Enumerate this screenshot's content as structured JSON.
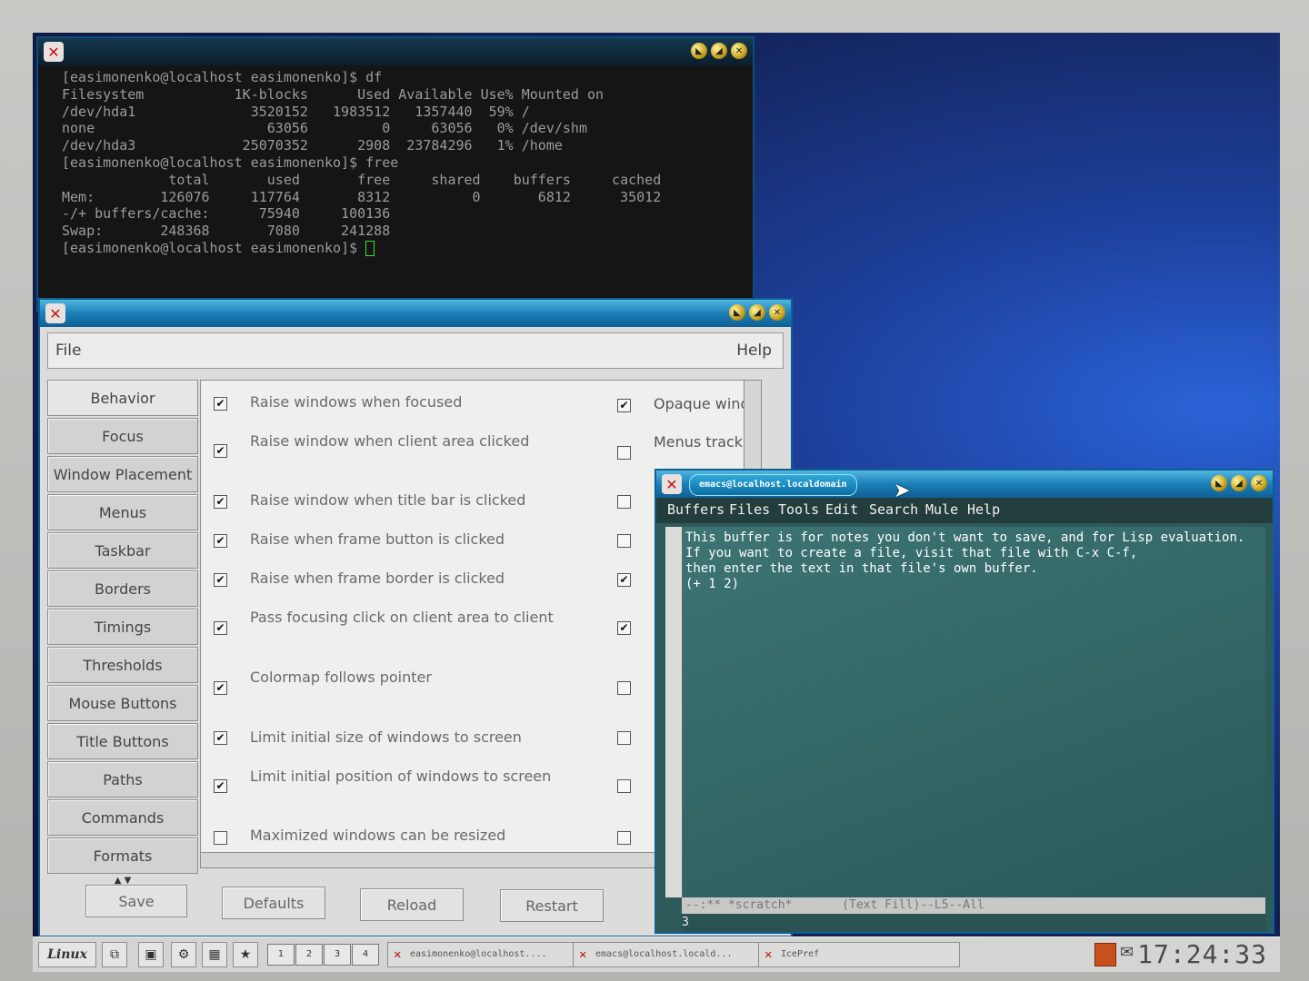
{
  "terminal": {
    "lines": [
      "[easimonenko@localhost easimonenko]$ df",
      "Filesystem           1K-blocks      Used Available Use% Mounted on",
      "/dev/hda1              3520152   1983512   1357440  59% /",
      "none                     63056         0     63056   0% /dev/shm",
      "/dev/hda3             25070352      2908  23784296   1% /home",
      "[easimonenko@localhost easimonenko]$ free",
      "             total       used       free     shared    buffers     cached",
      "Mem:        126076     117764       8312          0       6812      35012",
      "-/+ buffers/cache:      75940     100136",
      "Swap:       248368       7080     241288",
      "[easimonenko@localhost easimonenko]$ "
    ]
  },
  "icepref": {
    "menu_file": "File",
    "menu_help": "Help",
    "tabs": [
      "Behavior",
      "Focus",
      "Window Placement",
      "Menus",
      "Taskbar",
      "Borders",
      "Timings",
      "Thresholds",
      "Mouse Buttons",
      "Title Buttons",
      "Paths",
      "Commands",
      "Formats"
    ],
    "tab_arrows": "▲ ▼",
    "left_options": [
      {
        "label": "Raise windows when focused",
        "checked": "✔"
      },
      {
        "label": "Raise window when client area clicked",
        "checked": "✔"
      },
      {
        "label": "Raise window when title bar is clicked",
        "checked": "✔"
      },
      {
        "label": "Raise when frame button is clicked",
        "checked": "✔"
      },
      {
        "label": "Raise when frame border is clicked",
        "checked": "✔"
      },
      {
        "label": "Pass focusing click on client area to client",
        "checked": "✔"
      },
      {
        "label": "Colormap follows pointer",
        "checked": "✔"
      },
      {
        "label": "Limit initial size of windows to screen",
        "checked": "✔"
      },
      {
        "label": "Limit initial position of windows to screen",
        "checked": "✔"
      },
      {
        "label": "Maximized windows can be resized",
        "checked": ""
      }
    ],
    "right_checks": [
      "✔",
      "",
      "",
      "",
      "✔",
      "✔",
      "",
      "",
      "",
      ""
    ],
    "right_labels": [
      "Opaque windc",
      "Menus track m"
    ],
    "buttons": {
      "save": "Save",
      "defaults": "Defaults",
      "reload": "Reload",
      "restart": "Restart"
    }
  },
  "emacs": {
    "title": "emacs@localhost.localdomain",
    "menu": [
      "Buffers",
      "Files",
      "Tools",
      "Edit",
      "Search",
      "Mule",
      "Help"
    ],
    "buffer_lines": [
      "This buffer is for notes you don't want to save, and for Lisp evaluation.",
      "If you want to create a file, visit that file with C-x C-f,",
      "then enter the text in that file's own buffer.",
      "",
      "(+ 1 2)"
    ],
    "modeline": "--:** *scratch*       (Text Fill)--L5--All",
    "minibuffer": "3"
  },
  "taskbar": {
    "start_label": "Linux",
    "workspaces": [
      "1",
      "2",
      "3",
      "4"
    ],
    "tasks": [
      "easimonenko@localhost....",
      "emacs@localhost.locald...",
      "IcePref"
    ],
    "clock": "17:24:33"
  }
}
